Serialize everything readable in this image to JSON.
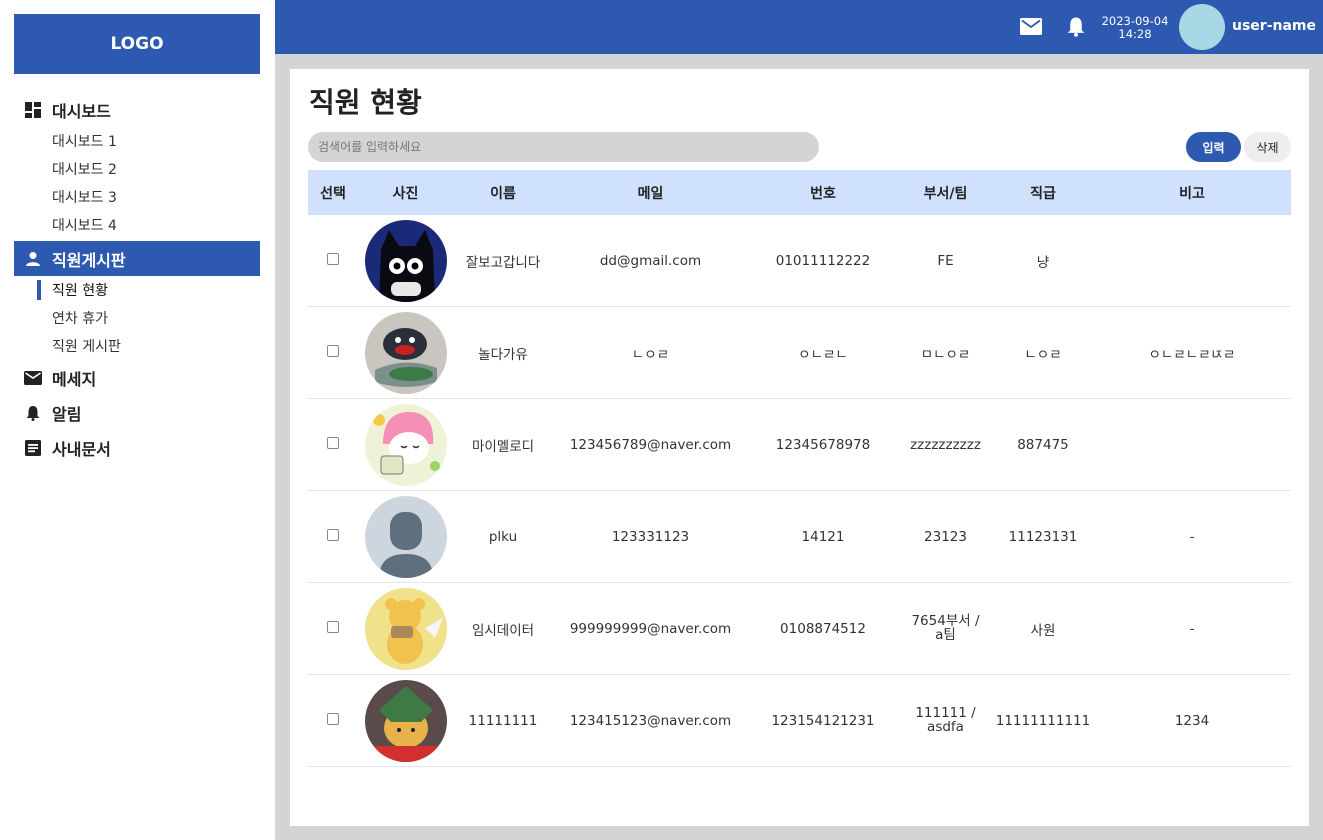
{
  "sidebar": {
    "logo": "LOGO",
    "groups": [
      {
        "label": "대시보드",
        "icon": "dashboard-icon",
        "items": [
          "대시보드 1",
          "대시보드 2",
          "대시보드 3",
          "대시보드 4"
        ]
      },
      {
        "label": "직원게시판",
        "icon": "person-icon",
        "items": [
          "직원 현황",
          "연차 휴가",
          "직원 게시판"
        ]
      },
      {
        "label": "메세지",
        "icon": "mail-icon"
      },
      {
        "label": "알림",
        "icon": "bell-icon"
      },
      {
        "label": "사내문서",
        "icon": "document-icon"
      }
    ]
  },
  "header": {
    "date": "2023-09-04",
    "time": "14:28",
    "user": "user-name"
  },
  "main": {
    "title": "직원 현황",
    "search_placeholder": "검색어를 입력하세요",
    "btn_input": "입력",
    "btn_delete": "삭제",
    "columns": [
      "선택",
      "사진",
      "이름",
      "메일",
      "번호",
      "부서/팀",
      "직급",
      "비고"
    ],
    "rows": [
      {
        "photo": "black-cat-photo",
        "name": "잘보고갑니다",
        "email": "dd@gmail.com",
        "phone": "01011112222",
        "dept": "FE",
        "rank": "냥",
        "note": ""
      },
      {
        "photo": "penguin-photo",
        "name": "놀다가유",
        "email": "ㄴㅇㄹ",
        "phone": "ㅇㄴㄹㄴ",
        "dept": "ㅁㄴㅇㄹ",
        "rank": "ㄴㅇㄹ",
        "note": "ㅇㄴㄹㄴㄹㄵㄹ"
      },
      {
        "photo": "my-melody-photo",
        "name": "마이멜로디",
        "email": "123456789@naver.com",
        "phone": "12345678978",
        "dept": "zzzzzzzzzz",
        "rank": "887475",
        "note": ""
      },
      {
        "photo": "default-avatar-photo",
        "name": "plku",
        "email": "123331123",
        "phone": "14121",
        "dept": "23123",
        "rank": "11123131",
        "note": "-"
      },
      {
        "photo": "cartoon-bear-photo",
        "name": "임시데이터",
        "email": "999999999@naver.com",
        "phone": "0108874512",
        "dept": "7654부서 / a팀",
        "rank": "사원",
        "note": "-"
      },
      {
        "photo": "pooh-photo",
        "name": "11111111",
        "email": "123415123@naver.com",
        "phone": "123154121231",
        "dept": "111111 / asdfa",
        "rank": "11111111111",
        "note": "1234"
      }
    ]
  },
  "colors": {
    "primary": "#2d59b0",
    "table_header": "#cfe1fc",
    "background": "#d4d4d6"
  }
}
